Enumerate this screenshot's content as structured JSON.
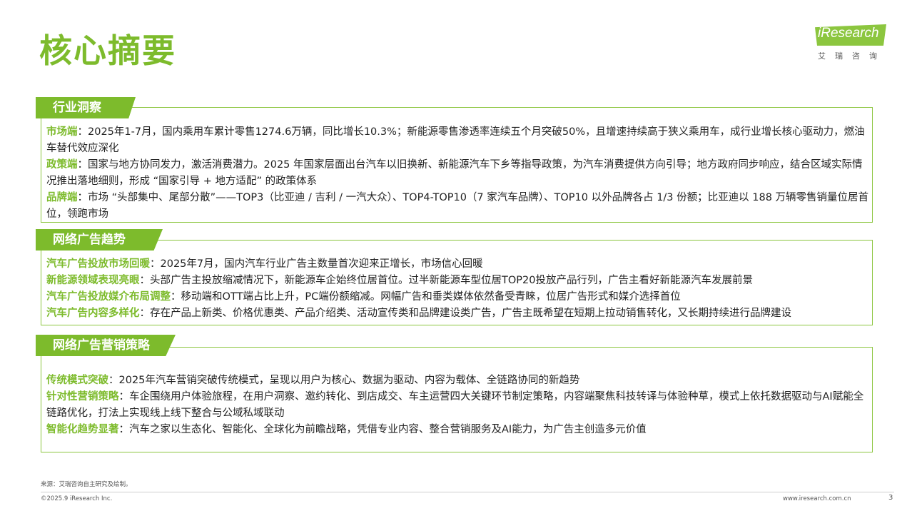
{
  "title": "核心摘要",
  "logo": {
    "brand": "iResearch",
    "sub": "艾瑞咨询"
  },
  "sections": [
    {
      "tag": "行业洞察",
      "rows": [
        {
          "kw": "市场端",
          "text": "：2025年1-7月，国内乘用车累计零售1274.6万辆，同比增长10.3%；新能源零售渗透率连续五个月突破50%，且增速持续高于狭义乘用车，成行业增长核心驱动力，燃油车替代效应深化"
        },
        {
          "kw": "政策端",
          "text": "：国家与地方协同发力，激活消费潜力。2025 年国家层面出台汽车以旧换新、新能源汽车下乡等指导政策，为汽车消费提供方向引导；地方政府同步响应，结合区域实际情况推出落地细则，形成 “国家引导 + 地方适配” 的政策体系"
        },
        {
          "kw": "品牌端",
          "text": "：市场 “头部集中、尾部分散”——TOP3（比亚迪 / 吉利 / 一汽大众）、TOP4-TOP10（7 家汽车品牌）、TOP10 以外品牌各占 1/3 份额；比亚迪以 188 万辆零售销量位居首位，领跑市场"
        }
      ]
    },
    {
      "tag": "网络广告趋势",
      "rows": [
        {
          "kw": "汽车广告投放市场回暖",
          "text": "：2025年7月，国内汽车行业广告主数量首次迎来正增长，市场信心回暖"
        },
        {
          "kw": "新能源领域表现亮眼",
          "text": "：头部广告主投放缩减情况下，新能源车企始终位居首位。过半新能源车型位居TOP20投放产品行列，广告主看好新能源汽车发展前景"
        },
        {
          "kw": "汽车广告投放媒介布局调整",
          "text": "：移动端和OTT端占比上升，PC端份额缩减。网幅广告和垂类媒体依然备受青睐，位居广告形式和媒介选择首位"
        },
        {
          "kw": "汽车广告内容多样化",
          "text": "：存在产品上新类、价格优惠类、产品介绍类、活动宣传类和品牌建设类广告，广告主既希望在短期上拉动销售转化，又长期持续进行品牌建设"
        }
      ]
    },
    {
      "tag": "网络广告营销策略",
      "rows": [
        {
          "kw": "传统模式突破",
          "text": "：2025年汽车营销突破传统模式，呈现以用户为核心、数据为驱动、内容为载体、全链路协同的新趋势"
        },
        {
          "kw": "针对性营销策略",
          "text": "：车企围绕用户体验旅程，在用户洞察、邀约转化、到店成交、车主运营四大关键环节制定策略，内容端聚焦科技转译与体验种草，模式上依托数据驱动与AI赋能全链路优化，打法上实现线上线下整合与公域私域联动"
        },
        {
          "kw": "智能化趋势显著",
          "text": "：汽车之家以生态化、智能化、全球化为前瞻战略，凭借专业内容、整合营销服务及AI能力，为广告主创造多元价值"
        }
      ]
    }
  ],
  "footer": {
    "source": "来源：艾瑞咨询自主研究及绘制。",
    "copyright": "©2025.9 iResearch Inc.",
    "url": "www.iresearch.com.cn",
    "page": "3"
  }
}
